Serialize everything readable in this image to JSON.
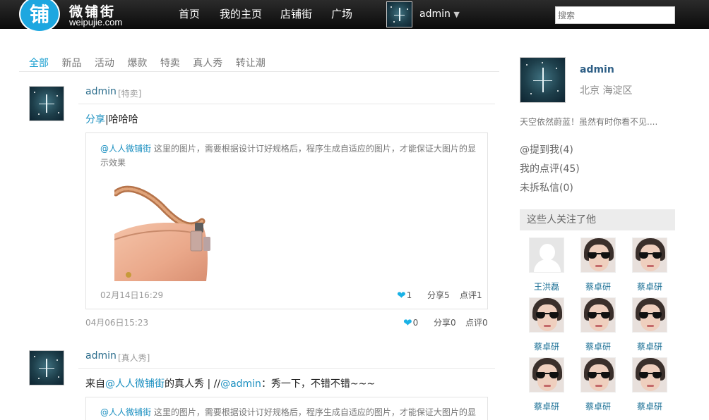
{
  "header": {
    "logo_char": "铺",
    "site_name": "微铺街",
    "domain": "weipujie.com",
    "nav": [
      "首页",
      "我的主页",
      "店铺街",
      "广场"
    ],
    "user": "admin",
    "search_placeholder": "搜索"
  },
  "tabs": [
    "全部",
    "新品",
    "活动",
    "爆款",
    "特卖",
    "真人秀",
    "转让潮"
  ],
  "posts": [
    {
      "user": "admin",
      "tag": "[特卖]",
      "body_link": "分享",
      "body_text": "|哈哈哈",
      "quote": {
        "mention": "@人人微铺街",
        "text": " 这里的图片，需要根据设计订好规格后，程序生成自适应的图片，才能保证大图片的显示效果",
        "time": "02月14日16:29",
        "likes": "1",
        "share": "分享5",
        "comment": "点评1"
      },
      "time": "04月06日15:23",
      "likes": "0",
      "share": "分享0",
      "comment": "点评0"
    },
    {
      "user": "admin",
      "tag": "[真人秀]",
      "body_pre": "来自",
      "body_link1": "@人人微铺街",
      "body_mid": "的真人秀 | //",
      "body_link2": "@admin",
      "body_post": "：秀一下，不错不错~~~",
      "quote": {
        "mention": "@人人微铺街",
        "text": " 这里的图片，需要根据设计订好规格后，程序生成自适应的图片，才能保证大图片的显"
      }
    }
  ],
  "sidebar": {
    "name": "admin",
    "location": "北京 海淀区",
    "bio": "天空依然蔚蓝！虽然有时你看不见....",
    "stats": [
      "@提到我(4)",
      "我的点评(45)",
      "未拆私信(0)"
    ],
    "followers_title": "这些人关注了他",
    "followers": [
      "王洪磊",
      "蔡卓研",
      "蔡卓研",
      "蔡卓研",
      "蔡卓研",
      "蔡卓研",
      "蔡卓研",
      "蔡卓研",
      "蔡卓研"
    ]
  }
}
